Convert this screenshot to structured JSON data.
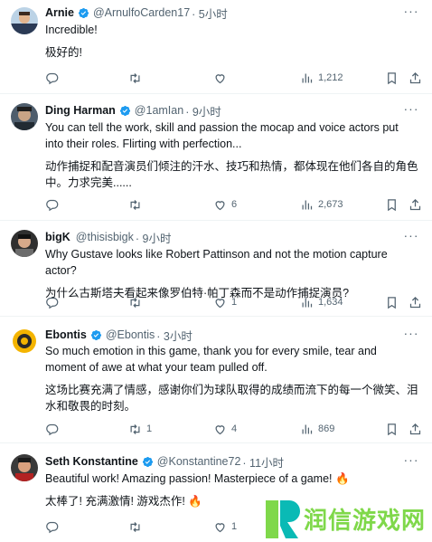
{
  "colors": {
    "verified": "#1d9bf0",
    "text": "#0f1419",
    "muted": "#536471",
    "divider": "#eff3f4",
    "watermark": "#7fd84a"
  },
  "tweets": [
    {
      "name": "Arnie",
      "verified": true,
      "handle": "@ArnulfoCarden17",
      "time": "· 5小时",
      "lines": [
        "Incredible!",
        "极好的!"
      ],
      "reply_count": "",
      "retweet_count": "",
      "like_count": "",
      "view_count": "1,212"
    },
    {
      "name": "Ding Harman",
      "verified": true,
      "handle": "@1amIan",
      "time": "· 9小时",
      "lines": [
        "You can tell the work, skill and passion the mocap and voice actors put into their roles. Flirting with perfection...",
        "动作捕捉和配音演员们倾注的汗水、技巧和热情，都体现在他们各自的角色中。力求完美......"
      ],
      "reply_count": "",
      "retweet_count": "",
      "like_count": "6",
      "view_count": "2,673"
    },
    {
      "name": "bigK",
      "verified": false,
      "handle": "@thisisbigk",
      "time": "· 9小时",
      "lines": [
        "Why Gustave looks like Robert Pattinson and not the motion capture actor?",
        "为什么古斯塔夫看起来像罗伯特·帕丁森而不是动作捕捉演员?"
      ],
      "reply_count": "",
      "retweet_count": "",
      "like_count": "1",
      "view_count": "1,634"
    },
    {
      "name": "Ebontis",
      "verified": true,
      "handle": "@Ebontis",
      "time": "· 3小时",
      "lines": [
        "So much emotion in this game, thank you for every smile, tear and moment of awe at what your team pulled off.",
        "这场比赛充满了情感，感谢你们为球队取得的成绩而流下的每一个微笑、泪水和敬畏的时刻。"
      ],
      "reply_count": "",
      "retweet_count": "1",
      "like_count": "4",
      "view_count": "869"
    },
    {
      "name": "Seth Konstantine",
      "verified": true,
      "handle": "@Konstantine72",
      "time": "· 11小时",
      "lines": [
        "Beautiful work! Amazing passion! Masterpiece of a game! 🔥",
        "太棒了! 充满激情! 游戏杰作! 🔥"
      ],
      "reply_count": "",
      "retweet_count": "",
      "like_count": "1",
      "view_count": ""
    }
  ],
  "more_glyph": "···",
  "icons": [
    "reply-icon",
    "retweet-icon",
    "like-icon",
    "views-icon",
    "bookmark-icon",
    "share-icon"
  ],
  "watermark": {
    "letter": "R",
    "text": "润信游戏网"
  }
}
